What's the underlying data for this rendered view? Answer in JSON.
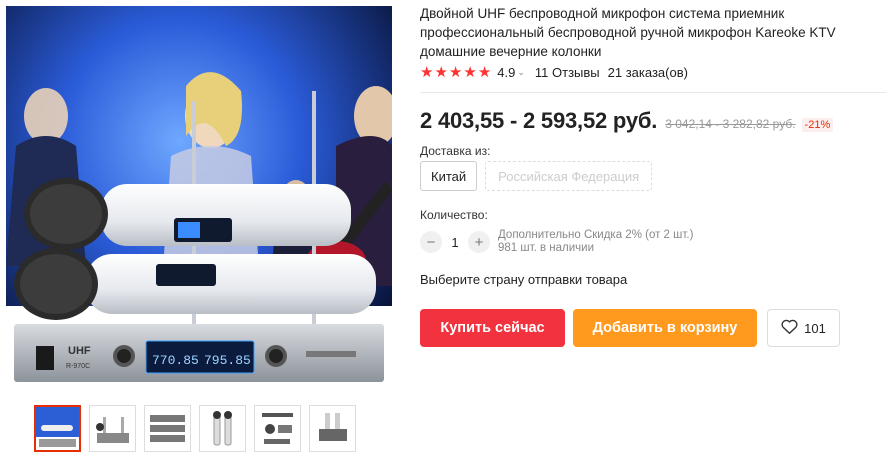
{
  "product": {
    "title": "Двойной UHF беспроводной микрофон система приемник профессиональный беспроводной ручной микрофон Kareoke KTV домашние вечерние колонки",
    "rating": "4.9",
    "stars": 5,
    "reviews": "11 Отзывы",
    "orders": "21 заказа(ов)"
  },
  "receiver": {
    "brand": "UHF",
    "model": "R-970C",
    "freq_a": "770.85",
    "freq_b": "795.85"
  },
  "price": {
    "current": "2 403,55 - 2 593,52 руб.",
    "old": "3 042,14 - 3 282,82 руб.",
    "discount": "-21%"
  },
  "shipping": {
    "label": "Доставка из:",
    "options": [
      "Китай",
      "Российская Федерация"
    ],
    "selected_index": 0
  },
  "quantity": {
    "label": "Количество:",
    "value": "1",
    "minus": "−",
    "plus": "+",
    "discount_note": "Дополнительно Скидка 2% (от 2 шт.)",
    "stock": "981 шт. в наличии"
  },
  "choose_text": "Выберите страну отправки товара",
  "buttons": {
    "buy": "Купить сейчас",
    "cart": "Добавить в корзину",
    "wishlist_count": "101"
  },
  "icons": {
    "star": "star-icon",
    "chevron": "chevron-down-icon",
    "heart": "heart-icon"
  },
  "colors": {
    "accent_red": "#f2333f",
    "accent_orange": "#ff9a1f",
    "discount_red": "#e62e04"
  },
  "gallery": {
    "thumb_count": 6,
    "active_index": 0
  }
}
